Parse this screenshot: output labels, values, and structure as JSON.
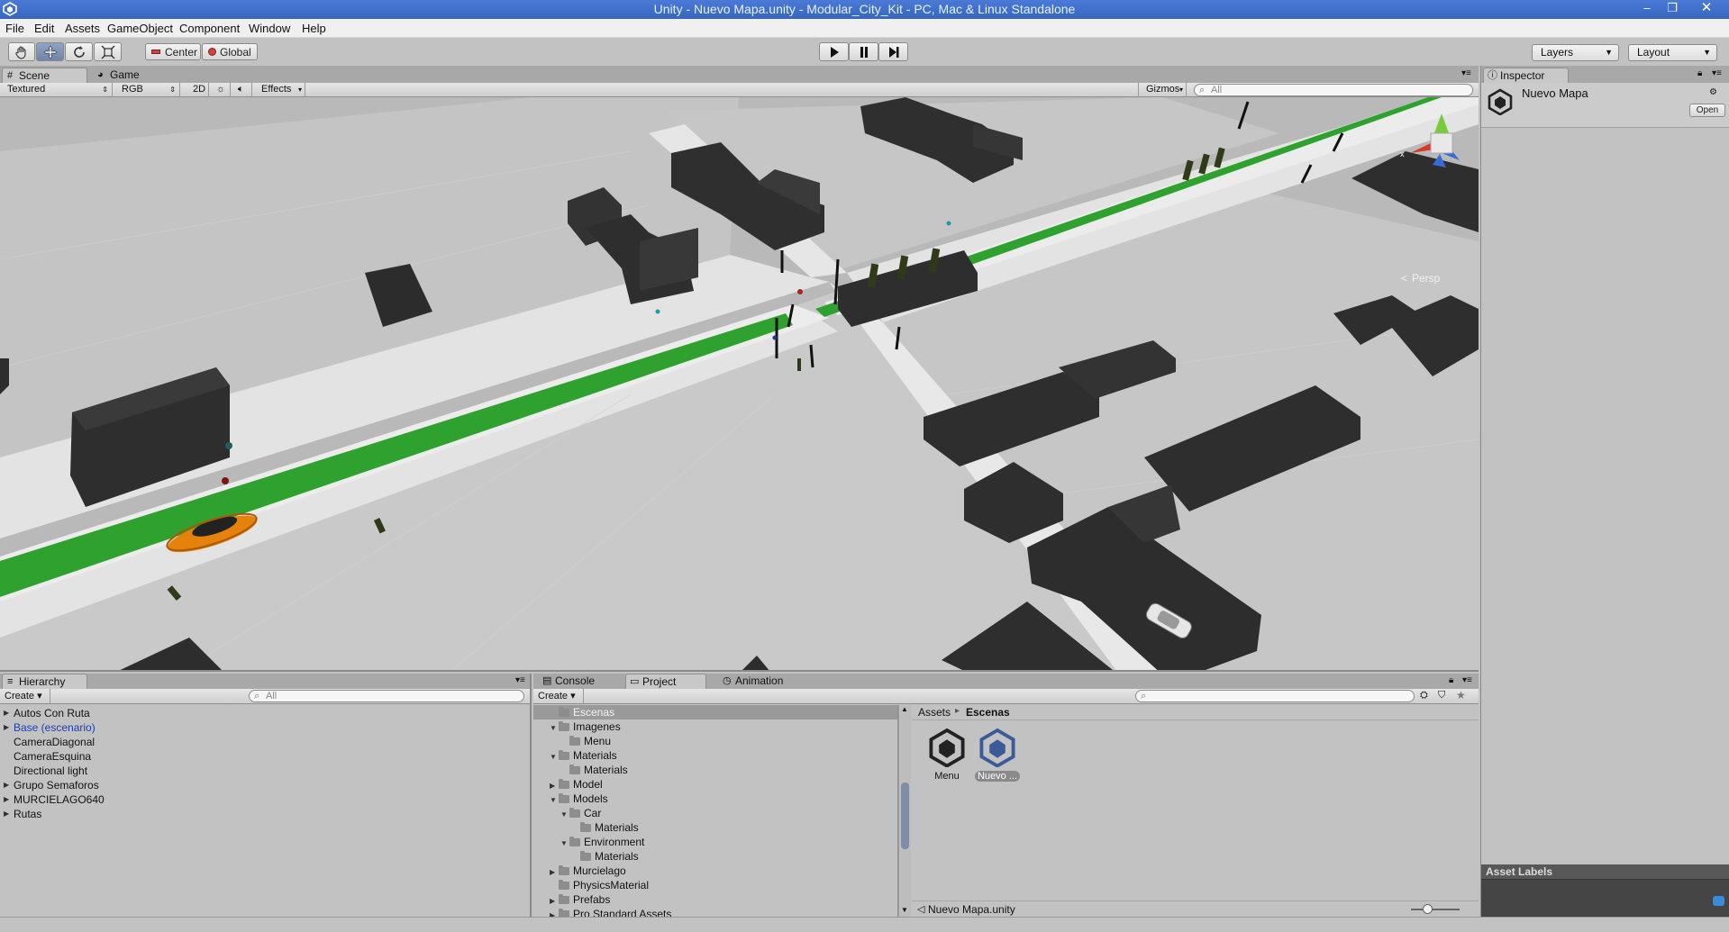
{
  "window": {
    "title": "Unity - Nuevo Mapa.unity - Modular_City_Kit - PC, Mac & Linux Standalone"
  },
  "menu": [
    "File",
    "Edit",
    "Assets",
    "GameObject",
    "Component",
    "Window",
    "Help"
  ],
  "toolbar": {
    "tools": [
      "hand-icon",
      "move-icon",
      "rotate-icon",
      "scale-icon"
    ],
    "pivot_label": "Center",
    "space_label": "Global",
    "playback": [
      "play-icon",
      "pause-icon",
      "step-icon"
    ],
    "layers_label": "Layers",
    "layout_label": "Layout"
  },
  "scene": {
    "tabs": [
      "Scene",
      "Game"
    ],
    "render_mode": "Textured",
    "color_mode": "RGB",
    "mode_2d": "2D",
    "effects_label": "Effects",
    "gizmos_label": "Gizmos",
    "search_placeholder": "All",
    "persp_label": "Persp",
    "gizmo_axis_x": "x",
    "gizmo_axis_y": "y",
    "gizmo_axis_z": "z"
  },
  "inspector": {
    "tab": "Inspector",
    "object_name": "Nuevo Mapa",
    "open_button": "Open",
    "asset_labels": "Asset Labels"
  },
  "hierarchy": {
    "tab": "Hierarchy",
    "create_label": "Create",
    "search_placeholder": "All",
    "items": [
      {
        "label": "Autos Con Ruta",
        "expandable": true
      },
      {
        "label": "Base (escenario)",
        "expandable": true,
        "highlight": true
      },
      {
        "label": "CameraDiagonal",
        "expandable": false
      },
      {
        "label": "CameraEsquina",
        "expandable": false
      },
      {
        "label": "Directional light",
        "expandable": false
      },
      {
        "label": "Grupo Semaforos",
        "expandable": true
      },
      {
        "label": "MURCIELAGO640",
        "expandable": true
      },
      {
        "label": "Rutas",
        "expandable": true
      }
    ]
  },
  "project": {
    "tabs": [
      "Console",
      "Project",
      "Animation"
    ],
    "create_label": "Create",
    "tree": [
      {
        "label": "Escenas",
        "depth": 0,
        "tri": "",
        "selected": true
      },
      {
        "label": "Imagenes",
        "depth": 0,
        "tri": "▼"
      },
      {
        "label": "Menu",
        "depth": 1,
        "tri": ""
      },
      {
        "label": "Materials",
        "depth": 0,
        "tri": "▼"
      },
      {
        "label": "Materials",
        "depth": 1,
        "tri": ""
      },
      {
        "label": "Model",
        "depth": 0,
        "tri": "▶"
      },
      {
        "label": "Models",
        "depth": 0,
        "tri": "▼"
      },
      {
        "label": "Car",
        "depth": 1,
        "tri": "▼"
      },
      {
        "label": "Materials",
        "depth": 2,
        "tri": ""
      },
      {
        "label": "Environment",
        "depth": 1,
        "tri": "▼"
      },
      {
        "label": "Materials",
        "depth": 2,
        "tri": ""
      },
      {
        "label": "Murcielago",
        "depth": 0,
        "tri": "▶"
      },
      {
        "label": "PhysicsMaterial",
        "depth": 0,
        "tri": ""
      },
      {
        "label": "Prefabs",
        "depth": 0,
        "tri": "▶"
      },
      {
        "label": "Pro Standard Assets",
        "depth": 0,
        "tri": "▶"
      }
    ],
    "breadcrumb_root": "Assets",
    "breadcrumb_sep": "▸",
    "breadcrumb_current": "Escenas",
    "assets": [
      {
        "label": "Menu",
        "selected": false
      },
      {
        "label": "Nuevo ...",
        "selected": true
      }
    ],
    "footer_file": "Nuevo Mapa.unity"
  },
  "colors": {
    "road_green": "#3aa63a",
    "building": "#333333",
    "ground": "#b6b6b6",
    "sidewalk": "#e2e2e2",
    "car_orange": "#f08c10",
    "title_blue": "#3766c0"
  }
}
